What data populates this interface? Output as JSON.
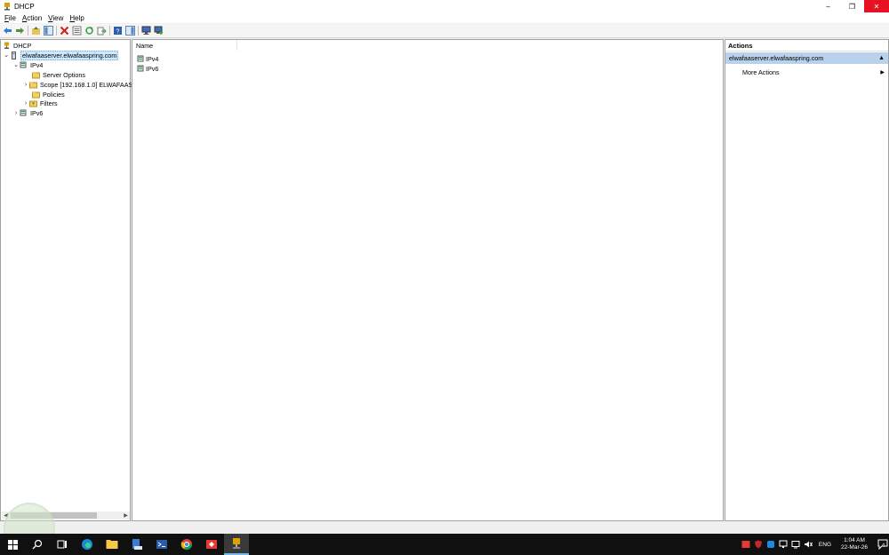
{
  "window": {
    "title": "DHCP",
    "controls": {
      "minimize": "–",
      "restore": "❐",
      "close": "✕"
    }
  },
  "menu": [
    "File",
    "Action",
    "View",
    "Help"
  ],
  "toolbar": {
    "buttons": [
      "back-icon",
      "forward-icon",
      "up-icon",
      "show-hide-tree-icon",
      "delete-icon",
      "properties-icon",
      "refresh-icon",
      "export-icon",
      "help-icon",
      "show-hide-action-pane-icon",
      "display-statistics-icon",
      "add-server-icon"
    ]
  },
  "tree": {
    "root": "DHCP",
    "server": "elwafaaserver.elwafaaspring.com",
    "ipv4": "IPv4",
    "server_options": "Server Options",
    "scope": "Scope [192.168.1.0] ELWAFAAS",
    "policies": "Policies",
    "filters": "Filters",
    "ipv6": "IPv6"
  },
  "content": {
    "column_name": "Name",
    "rows": [
      "IPv4",
      "IPv6"
    ]
  },
  "actions": {
    "header": "Actions",
    "group": "elwafaaserver.elwafaaspring.com",
    "items": [
      "More Actions"
    ]
  },
  "taskbar": {
    "language": "ENG",
    "time": "1:04 AM",
    "date": "22-Mar-26",
    "notifications": "4"
  },
  "colors": {
    "selection": "#cce8ff",
    "actions_group": "#b9d1ea",
    "close_button": "#e81123",
    "taskbar": "#101010"
  }
}
